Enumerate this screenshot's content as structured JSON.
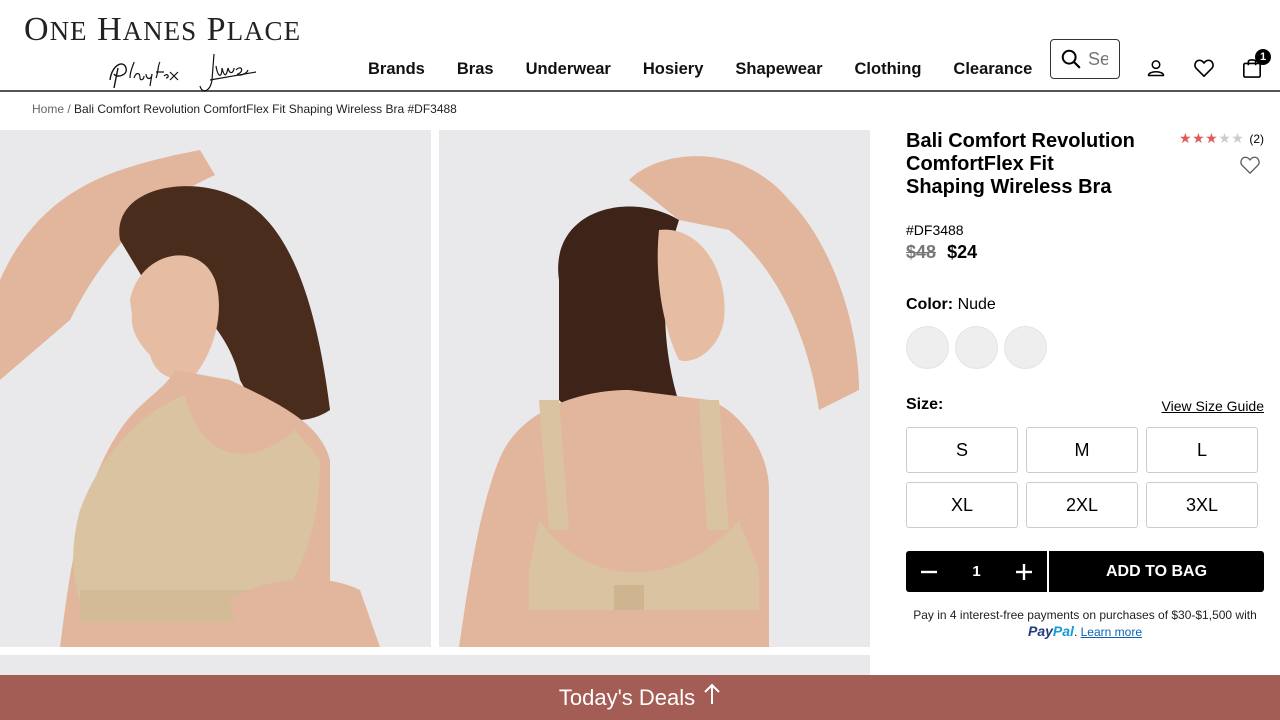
{
  "header": {
    "logo": "One Hanes Place",
    "sub_logos": [
      "Playtex",
      "jms"
    ],
    "search_placeholder": "Search",
    "bag_count": "1"
  },
  "nav": [
    {
      "label": "Brands"
    },
    {
      "label": "Bras"
    },
    {
      "label": "Underwear"
    },
    {
      "label": "Hosiery"
    },
    {
      "label": "Shapewear"
    },
    {
      "label": "Clothing"
    },
    {
      "label": "Clearance"
    }
  ],
  "breadcrumb": {
    "home": "Home",
    "separator": "/",
    "current": "Bali Comfort Revolution ComfortFlex Fit Shaping Wireless Bra #DF3488"
  },
  "product": {
    "title": "Bali Comfort Revolution ComfortFlex Fit Shaping Wireless Bra",
    "sku": "#DF3488",
    "old_price": "$48",
    "price": "$24",
    "rating": 3,
    "rating_max": 5,
    "review_count": "(2)",
    "color_label": "Color:",
    "color_value": "Nude",
    "swatch_count": 3,
    "size_label": "Size:",
    "size_guide": "View Size Guide",
    "sizes": [
      "S",
      "M",
      "L",
      "XL",
      "2XL",
      "3XL"
    ],
    "quantity": "1",
    "add_to_bag": "ADD TO BAG"
  },
  "paypal": {
    "text_before": "Pay in 4 interest-free payments on purchases of $30-$1,500 with",
    "brand_1": "Pay",
    "brand_2": "Pal",
    "period": ".",
    "learn_more": "Learn more"
  },
  "deals": {
    "label": "Today's Deals"
  },
  "colors": {
    "deals_bar": "#a45d55",
    "star_on": "#e05a5a",
    "star_off": "#cccccc",
    "image_bg": "#e9e9eb",
    "skin_nude": "#d9c3a0"
  }
}
